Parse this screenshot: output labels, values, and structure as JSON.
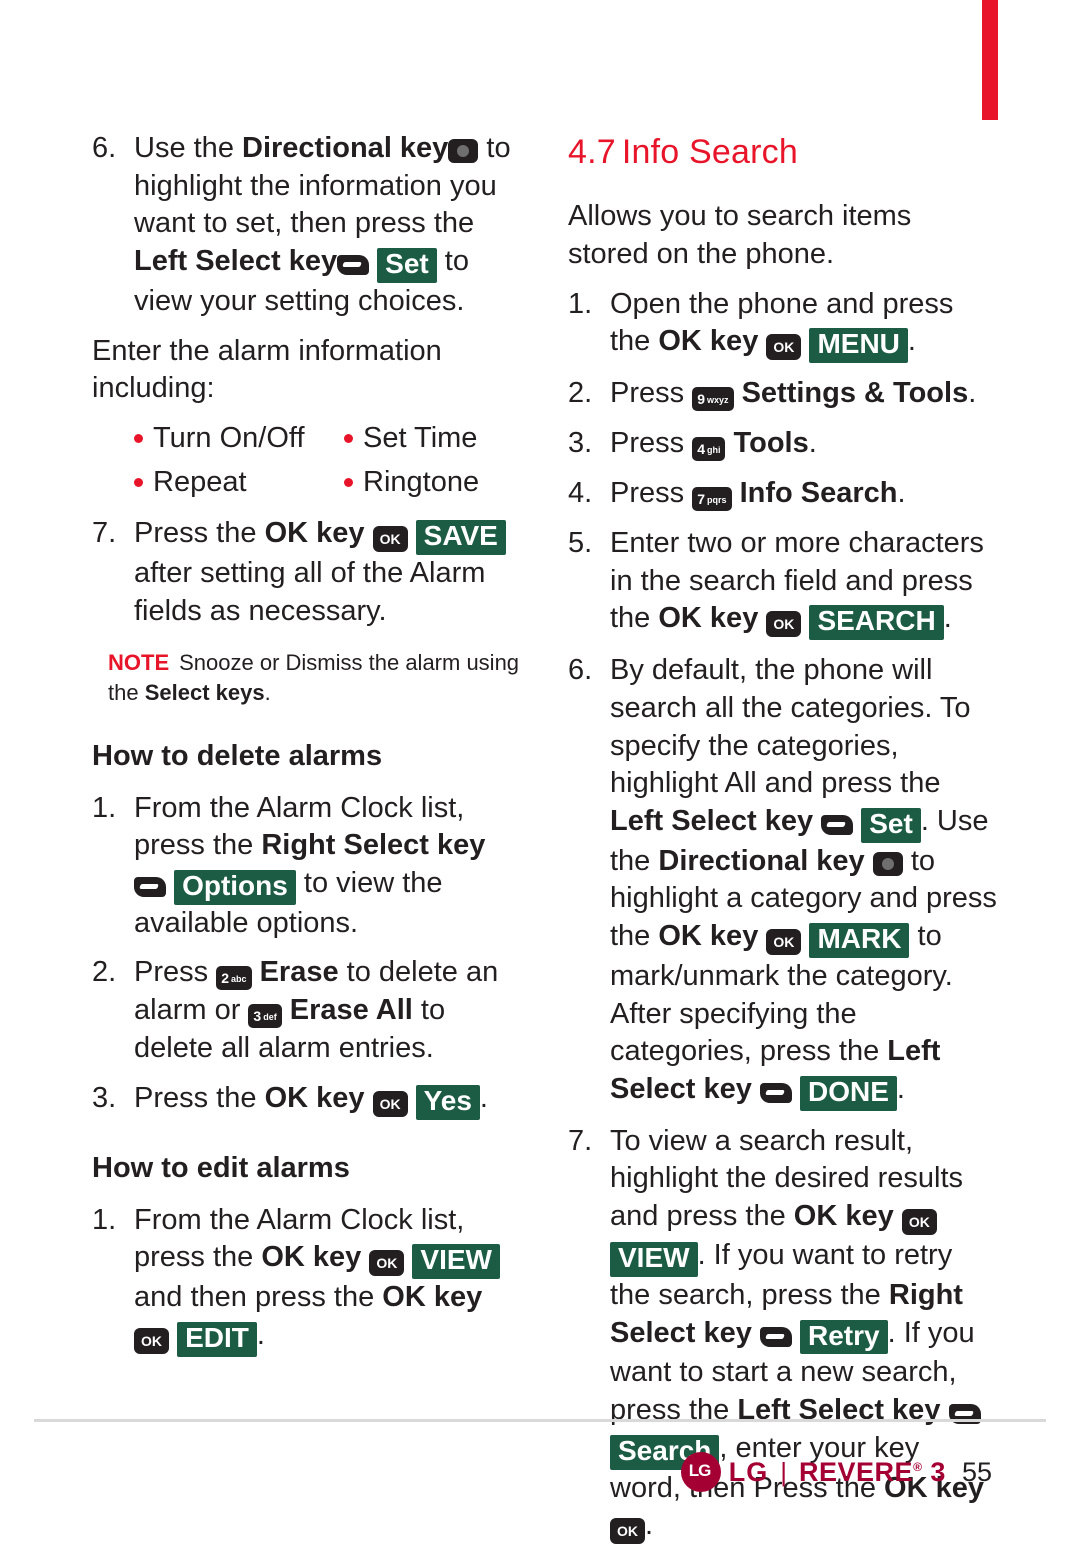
{
  "page": {
    "number": "55",
    "brand": "LG",
    "model": "REVERE",
    "model_suffix": "3",
    "trademark": "®"
  },
  "left_column": {
    "step6": {
      "num": "6.",
      "t1": "Use the ",
      "b1": "Directional key",
      "t2": " to highlight the information you want to set, then press the ",
      "b2": "Left Select key",
      "chip": "Set",
      "t3": " to view your setting choices."
    },
    "enter_info": "Enter the alarm information including:",
    "bullets": [
      "Turn On/Off",
      "Set Time",
      "Repeat",
      "Ringtone"
    ],
    "step7": {
      "num": "7.",
      "t1": "Press the ",
      "b1": "OK key",
      "chip": "SAVE",
      "t2": " after setting all of the Alarm fields as necessary."
    },
    "note": {
      "label": "NOTE",
      "t1": "Snooze or Dismiss the alarm using the ",
      "b1": "Select keys",
      "t2": "."
    },
    "delete_heading": "How to delete alarms",
    "delete_steps": [
      {
        "num": "1.",
        "t1": "From the Alarm Clock list, press the ",
        "b1": "Right Select key",
        "chip": "Options",
        "t2": " to view the available options."
      },
      {
        "num": "2.",
        "t1": "Press ",
        "key1": "2",
        "key1sub": "abc",
        "b1": "Erase",
        "t2": " to delete an alarm or ",
        "key2": "3",
        "key2sub": "def",
        "b2": "Erase All",
        "t3": " to delete all alarm entries."
      },
      {
        "num": "3.",
        "t1": "Press the ",
        "b1": "OK key",
        "chip": "Yes",
        "t2": "."
      }
    ],
    "edit_heading": "How to edit alarms",
    "edit_steps": [
      {
        "num": "1.",
        "t1": "From the Alarm Clock list, press the ",
        "b1": "OK key",
        "chip": "VIEW",
        "t2": " and then press the ",
        "b2": "OK key",
        "chip2": "EDIT",
        "t3": "."
      }
    ]
  },
  "right_column": {
    "section_number": "4.7",
    "section_title": "Info Search",
    "intro": "Allows you to search items stored on the phone.",
    "steps": [
      {
        "num": "1.",
        "t1": "Open the phone and press the ",
        "b1": "OK key",
        "chip": "MENU",
        "t2": "."
      },
      {
        "num": "2.",
        "t1": "Press ",
        "key": "9",
        "keysub": "wxyz",
        "b1": "Settings & Tools",
        "t2": "."
      },
      {
        "num": "3.",
        "t1": "Press ",
        "key": "4",
        "keysub": "ghi",
        "b1": "Tools",
        "t2": "."
      },
      {
        "num": "4.",
        "t1": "Press ",
        "key": "7",
        "keysub": "pqrs",
        "b1": "Info Search",
        "t2": "."
      },
      {
        "num": "5.",
        "t1": "Enter two or more characters in the search field and press the ",
        "b1": "OK key",
        "chip": "SEARCH",
        "t2": "."
      },
      {
        "num": "6.",
        "t1": "By default, the phone will search all the categories. To specify the categories, highlight All and press the ",
        "b1": "Left Select key",
        "chip1": "Set",
        "t2": ". Use the ",
        "b2": "Directional key",
        "t3": " to highlight a category and press the ",
        "b3": "OK key",
        "chip2": "MARK",
        "t4": " to mark/unmark the category. After specifying the categories, press the ",
        "b4": "Left Select key",
        "chip3": "DONE",
        "t5": "."
      },
      {
        "num": "7.",
        "t1": "To view a search result, highlight the desired results and press the ",
        "b1": "OK key",
        "chip1": "VIEW",
        "t2": ". If you want to retry the search, press the ",
        "b2": "Right Select key",
        "chip2": "Retry",
        "t3": ". If you want to start a new search, press the ",
        "b3": "Left Select key",
        "chip3": "Search",
        "t4": ", enter your key word, then Press the ",
        "b4": "OK key",
        "t5": "."
      }
    ]
  },
  "icons": {
    "ok_key": "OK",
    "directional": "directional-pad",
    "soft_key": "soft-select-key"
  },
  "colors": {
    "accent_red": "#e8152a",
    "chip_green": "#1d5c44",
    "brand": "#a50034",
    "text": "#231f20"
  }
}
